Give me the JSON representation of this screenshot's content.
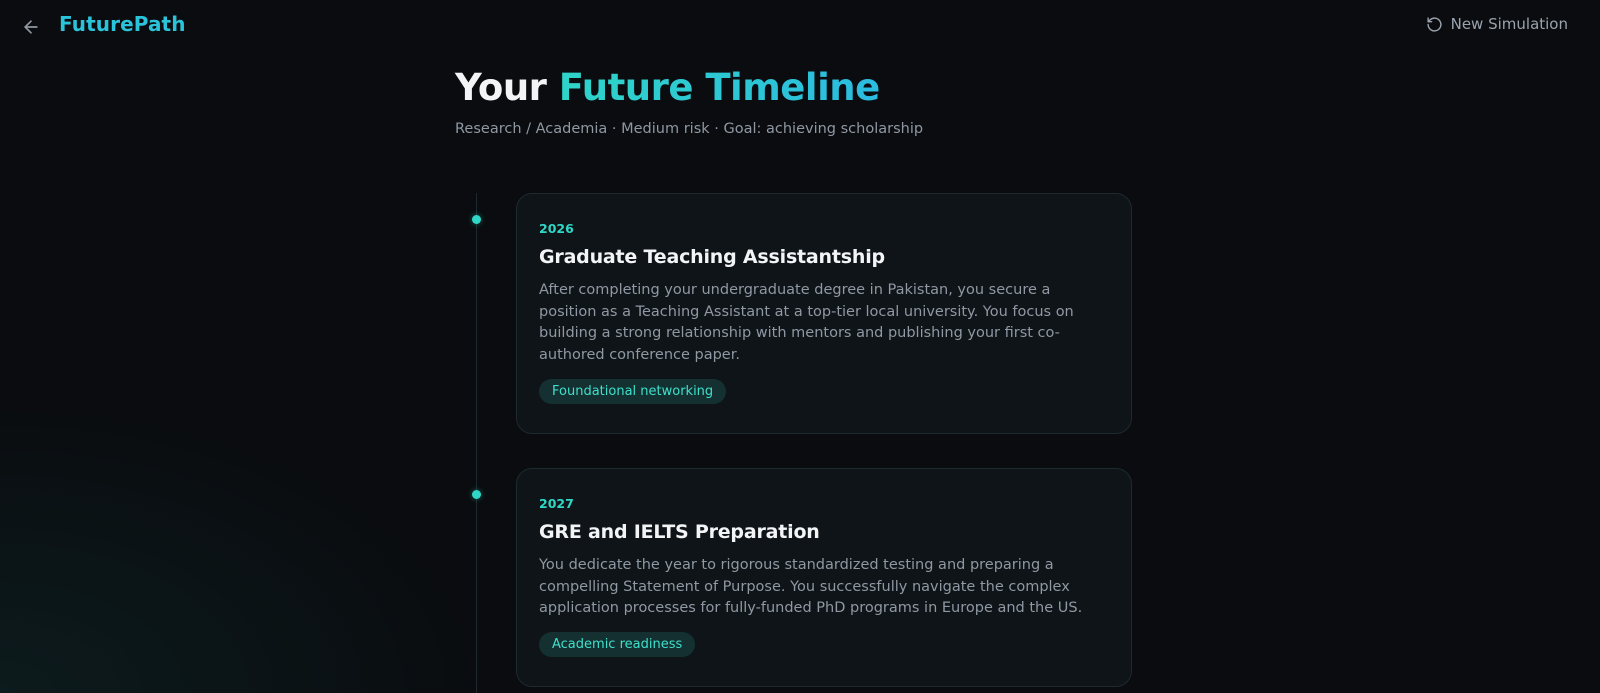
{
  "header": {
    "back_icon": "arrow-left-icon",
    "brand": "FuturePath",
    "new_simulation_icon": "rotate-ccw-icon",
    "new_simulation_label": "New Simulation"
  },
  "page": {
    "title_prefix": "Your",
    "title_highlight": "Future Timeline",
    "subtitle": "Research / Academia · Medium risk · Goal: achieving scholarship"
  },
  "timeline": [
    {
      "year": "2026",
      "title": "Graduate Teaching Assistantship",
      "description": "After completing your undergraduate degree in Pakistan, you secure a position as a Teaching Assistant at a top-tier local university. You focus on building a strong relationship with mentors and publishing your first co-authored conference paper.",
      "tag": "Foundational networking"
    },
    {
      "year": "2027",
      "title": "GRE and IELTS Preparation",
      "description": "You dedicate the year to rigorous standardized testing and preparing a compelling Statement of Purpose. You successfully navigate the complex application processes for fully-funded PhD programs in Europe and the US.",
      "tag": "Academic readiness"
    }
  ],
  "colors": {
    "accent": "#2fd8c6",
    "brand": "#2bc3d9",
    "background": "#0a0c0f",
    "card": "#0f1418"
  }
}
